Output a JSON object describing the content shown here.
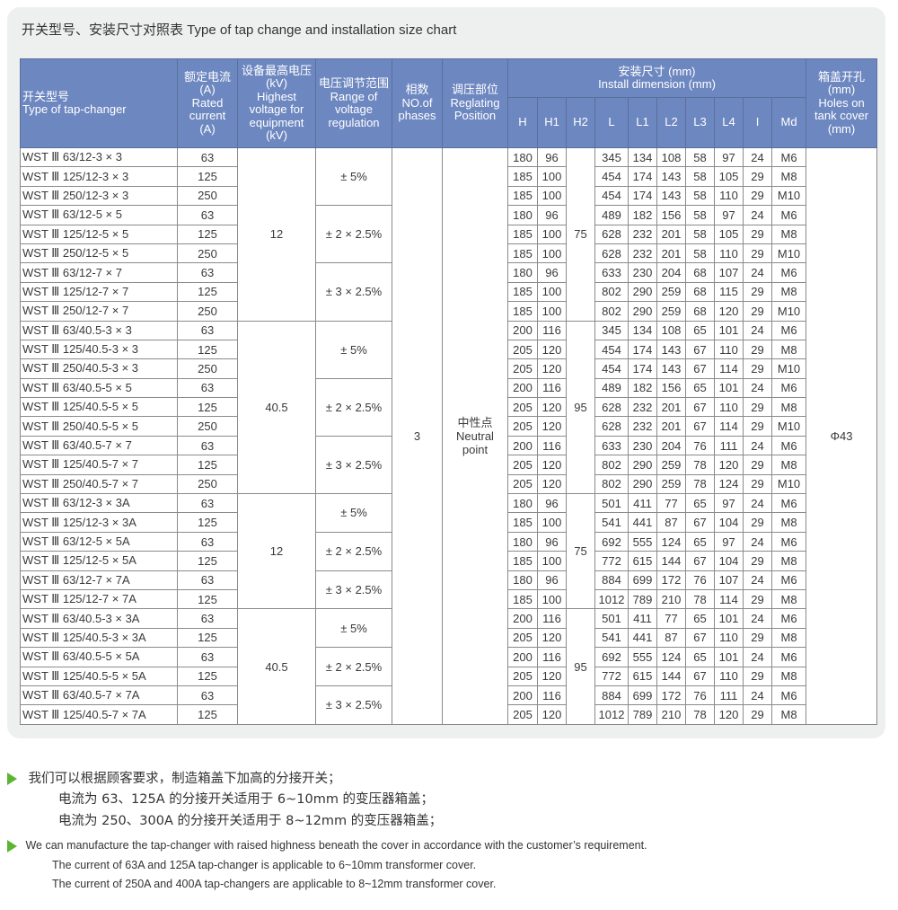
{
  "title": "开关型号、安装尺寸对照表   Type of tap change and installation size chart",
  "header": {
    "model": [
      "开关型号",
      "Type of tap-changer"
    ],
    "rated": [
      "额定电流",
      "(A)",
      "Rated",
      "current",
      "(A)"
    ],
    "voltage": [
      "设备最高电压",
      "(kV)",
      "Highest",
      "voltage for",
      "equipment",
      "(kV)"
    ],
    "range": [
      "电压调节范围",
      "Range of",
      "voltage",
      "regulation"
    ],
    "phases": [
      "相数",
      "NO.of",
      "phases"
    ],
    "position": [
      "调压部位",
      "Reglating",
      "Position"
    ],
    "install": [
      "安装尺寸 (mm)",
      "Install dimension (mm)"
    ],
    "install_cols": [
      "H",
      "H1",
      "H2",
      "L",
      "L1",
      "L2",
      "L3",
      "L4",
      "I",
      "Md"
    ],
    "holes": [
      "箱盖开孔",
      "(mm)",
      "Holes on",
      "tank cover",
      "(mm)"
    ]
  },
  "merged": {
    "phases": "3",
    "position": [
      "中性点",
      "Neutral",
      "point"
    ],
    "holes": "Φ43"
  },
  "groups": [
    {
      "voltage": "12",
      "h2": "75",
      "ranges": [
        {
          "label": "± 5%",
          "rows": 3
        },
        {
          "label": "± 2 × 2.5%",
          "rows": 3
        },
        {
          "label": "± 3 × 2.5%",
          "rows": 3
        }
      ],
      "rows": [
        {
          "model": "WST Ⅲ 63/12-3 × 3",
          "rated": "63",
          "H": "180",
          "H1": "96",
          "L": "345",
          "L1": "134",
          "L2": "108",
          "L3": "58",
          "L4": "97",
          "I": "24",
          "Md": "M6"
        },
        {
          "model": "WST Ⅲ 125/12-3 × 3",
          "rated": "125",
          "H": "185",
          "H1": "100",
          "L": "454",
          "L1": "174",
          "L2": "143",
          "L3": "58",
          "L4": "105",
          "I": "29",
          "Md": "M8"
        },
        {
          "model": "WST Ⅲ 250/12-3 × 3",
          "rated": "250",
          "H": "185",
          "H1": "100",
          "L": "454",
          "L1": "174",
          "L2": "143",
          "L3": "58",
          "L4": "110",
          "I": "29",
          "Md": "M10"
        },
        {
          "model": "WST Ⅲ 63/12-5 × 5",
          "rated": "63",
          "H": "180",
          "H1": "96",
          "L": "489",
          "L1": "182",
          "L2": "156",
          "L3": "58",
          "L4": "97",
          "I": "24",
          "Md": "M6"
        },
        {
          "model": "WST Ⅲ 125/12-5 × 5",
          "rated": "125",
          "H": "185",
          "H1": "100",
          "L": "628",
          "L1": "232",
          "L2": "201",
          "L3": "58",
          "L4": "105",
          "I": "29",
          "Md": "M8"
        },
        {
          "model": "WST Ⅲ 250/12-5 × 5",
          "rated": "250",
          "H": "185",
          "H1": "100",
          "L": "628",
          "L1": "232",
          "L2": "201",
          "L3": "58",
          "L4": "110",
          "I": "29",
          "Md": "M10"
        },
        {
          "model": "WST Ⅲ 63/12-7 × 7",
          "rated": "63",
          "H": "180",
          "H1": "96",
          "L": "633",
          "L1": "230",
          "L2": "204",
          "L3": "68",
          "L4": "107",
          "I": "24",
          "Md": "M6"
        },
        {
          "model": "WST Ⅲ 125/12-7 × 7",
          "rated": "125",
          "H": "185",
          "H1": "100",
          "L": "802",
          "L1": "290",
          "L2": "259",
          "L3": "68",
          "L4": "115",
          "I": "29",
          "Md": "M8"
        },
        {
          "model": "WST Ⅲ 250/12-7 × 7",
          "rated": "250",
          "H": "185",
          "H1": "100",
          "L": "802",
          "L1": "290",
          "L2": "259",
          "L3": "68",
          "L4": "120",
          "I": "29",
          "Md": "M10"
        }
      ]
    },
    {
      "voltage": "40.5",
      "h2": "95",
      "ranges": [
        {
          "label": "± 5%",
          "rows": 3
        },
        {
          "label": "± 2 × 2.5%",
          "rows": 3
        },
        {
          "label": "± 3 × 2.5%",
          "rows": 3
        }
      ],
      "rows": [
        {
          "model": "WST Ⅲ 63/40.5-3 × 3",
          "rated": "63",
          "H": "200",
          "H1": "116",
          "L": "345",
          "L1": "134",
          "L2": "108",
          "L3": "65",
          "L4": "101",
          "I": "24",
          "Md": "M6"
        },
        {
          "model": "WST Ⅲ 125/40.5-3 × 3",
          "rated": "125",
          "H": "205",
          "H1": "120",
          "L": "454",
          "L1": "174",
          "L2": "143",
          "L3": "67",
          "L4": "110",
          "I": "29",
          "Md": "M8"
        },
        {
          "model": "WST Ⅲ 250/40.5-3 × 3",
          "rated": "250",
          "H": "205",
          "H1": "120",
          "L": "454",
          "L1": "174",
          "L2": "143",
          "L3": "67",
          "L4": "114",
          "I": "29",
          "Md": "M10"
        },
        {
          "model": "WST Ⅲ 63/40.5-5 × 5",
          "rated": "63",
          "H": "200",
          "H1": "116",
          "L": "489",
          "L1": "182",
          "L2": "156",
          "L3": "65",
          "L4": "101",
          "I": "24",
          "Md": "M6"
        },
        {
          "model": "WST Ⅲ 125/40.5-5 × 5",
          "rated": "125",
          "H": "205",
          "H1": "120",
          "L": "628",
          "L1": "232",
          "L2": "201",
          "L3": "67",
          "L4": "110",
          "I": "29",
          "Md": "M8"
        },
        {
          "model": "WST Ⅲ 250/40.5-5 × 5",
          "rated": "250",
          "H": "205",
          "H1": "120",
          "L": "628",
          "L1": "232",
          "L2": "201",
          "L3": "67",
          "L4": "114",
          "I": "29",
          "Md": "M10"
        },
        {
          "model": "WST Ⅲ 63/40.5-7 × 7",
          "rated": "63",
          "H": "200",
          "H1": "116",
          "L": "633",
          "L1": "230",
          "L2": "204",
          "L3": "76",
          "L4": "111",
          "I": "24",
          "Md": "M6"
        },
        {
          "model": "WST Ⅲ 125/40.5-7 × 7",
          "rated": "125",
          "H": "205",
          "H1": "120",
          "L": "802",
          "L1": "290",
          "L2": "259",
          "L3": "78",
          "L4": "120",
          "I": "29",
          "Md": "M8"
        },
        {
          "model": "WST Ⅲ 250/40.5-7 × 7",
          "rated": "250",
          "H": "205",
          "H1": "120",
          "L": "802",
          "L1": "290",
          "L2": "259",
          "L3": "78",
          "L4": "124",
          "I": "29",
          "Md": "M10"
        }
      ]
    },
    {
      "voltage": "12",
      "h2": "75",
      "ranges": [
        {
          "label": "± 5%",
          "rows": 2
        },
        {
          "label": "± 2 × 2.5%",
          "rows": 2
        },
        {
          "label": "± 3 × 2.5%",
          "rows": 2
        }
      ],
      "rows": [
        {
          "model": "WST Ⅲ 63/12-3 × 3A",
          "rated": "63",
          "H": "180",
          "H1": "96",
          "L": "501",
          "L1": "411",
          "L2": "77",
          "L3": "65",
          "L4": "97",
          "I": "24",
          "Md": "M6"
        },
        {
          "model": "WST Ⅲ 125/12-3 × 3A",
          "rated": "125",
          "H": "185",
          "H1": "100",
          "L": "541",
          "L1": "441",
          "L2": "87",
          "L3": "67",
          "L4": "104",
          "I": "29",
          "Md": "M8"
        },
        {
          "model": "WST Ⅲ 63/12-5 × 5A",
          "rated": "63",
          "H": "180",
          "H1": "96",
          "L": "692",
          "L1": "555",
          "L2": "124",
          "L3": "65",
          "L4": "97",
          "I": "24",
          "Md": "M6"
        },
        {
          "model": "WST Ⅲ 125/12-5 × 5A",
          "rated": "125",
          "H": "185",
          "H1": "100",
          "L": "772",
          "L1": "615",
          "L2": "144",
          "L3": "67",
          "L4": "104",
          "I": "29",
          "Md": "M8"
        },
        {
          "model": "WST Ⅲ 63/12-7 × 7A",
          "rated": "63",
          "H": "180",
          "H1": "96",
          "L": "884",
          "L1": "699",
          "L2": "172",
          "L3": "76",
          "L4": "107",
          "I": "24",
          "Md": "M6"
        },
        {
          "model": "WST Ⅲ 125/12-7 × 7A",
          "rated": "125",
          "H": "185",
          "H1": "100",
          "L": "1012",
          "L1": "789",
          "L2": "210",
          "L3": "78",
          "L4": "114",
          "I": "29",
          "Md": "M8"
        }
      ]
    },
    {
      "voltage": "40.5",
      "h2": "95",
      "ranges": [
        {
          "label": "± 5%",
          "rows": 2
        },
        {
          "label": "± 2 × 2.5%",
          "rows": 2
        },
        {
          "label": "± 3 × 2.5%",
          "rows": 2
        }
      ],
      "rows": [
        {
          "model": "WST Ⅲ 63/40.5-3 × 3A",
          "rated": "63",
          "H": "200",
          "H1": "116",
          "L": "501",
          "L1": "411",
          "L2": "77",
          "L3": "65",
          "L4": "101",
          "I": "24",
          "Md": "M6"
        },
        {
          "model": "WST Ⅲ 125/40.5-3 × 3A",
          "rated": "125",
          "H": "205",
          "H1": "120",
          "L": "541",
          "L1": "441",
          "L2": "87",
          "L3": "67",
          "L4": "110",
          "I": "29",
          "Md": "M8"
        },
        {
          "model": "WST Ⅲ 63/40.5-5 × 5A",
          "rated": "63",
          "H": "200",
          "H1": "116",
          "L": "692",
          "L1": "555",
          "L2": "124",
          "L3": "65",
          "L4": "101",
          "I": "24",
          "Md": "M6"
        },
        {
          "model": "WST Ⅲ 125/40.5-5 × 5A",
          "rated": "125",
          "H": "205",
          "H1": "120",
          "L": "772",
          "L1": "615",
          "L2": "144",
          "L3": "67",
          "L4": "110",
          "I": "29",
          "Md": "M8"
        },
        {
          "model": "WST Ⅲ 63/40.5-7 × 7A",
          "rated": "63",
          "H": "200",
          "H1": "116",
          "L": "884",
          "L1": "699",
          "L2": "172",
          "L3": "76",
          "L4": "111",
          "I": "24",
          "Md": "M6"
        },
        {
          "model": "WST Ⅲ 125/40.5-7 × 7A",
          "rated": "125",
          "H": "205",
          "H1": "120",
          "L": "1012",
          "L1": "789",
          "L2": "210",
          "L3": "78",
          "L4": "120",
          "I": "29",
          "Md": "M8"
        }
      ]
    }
  ],
  "notes": {
    "cn": [
      "我们可以根据顾客要求，制造箱盖下加高的分接开关；",
      "电流为 63、125A 的分接开关适用于 6~10mm 的变压器箱盖；",
      "电流为 250、300A 的分接开关适用于 8~12mm 的变压器箱盖；"
    ],
    "en": [
      "We can manufacture the tap-changer with raised highness beneath the cover in accordance with the customer’s requirement.",
      "The current of 63A and 125A tap-changer is applicable to 6~10mm transformer cover.",
      "The current of 250A and 400A tap-changers are applicable to 8~12mm transformer cover."
    ],
    "bullet_color": "#5cb531"
  },
  "colors": {
    "header_bg": "#6d87c0",
    "panel_bg": "#eef0f0"
  }
}
